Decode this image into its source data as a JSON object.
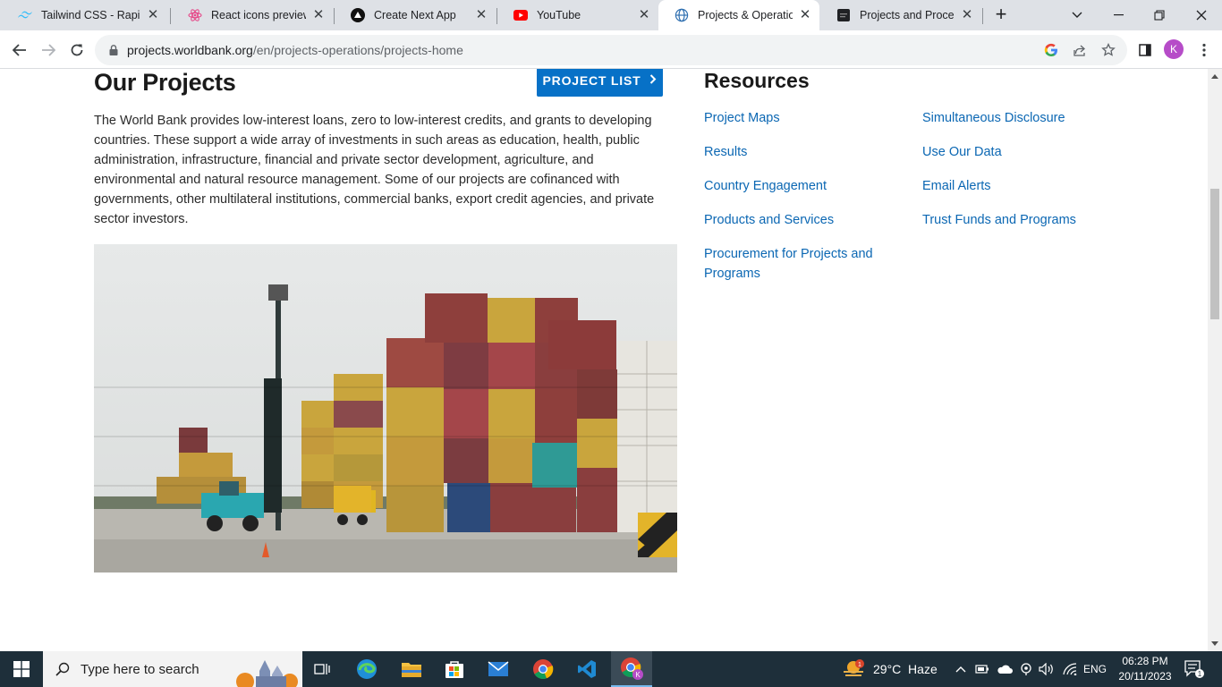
{
  "browser": {
    "tabs": [
      {
        "title": "Tailwind CSS - Rapidly",
        "icon": "tailwind-icon",
        "active": false
      },
      {
        "title": "React icons preview fo",
        "icon": "react-icon",
        "active": false
      },
      {
        "title": "Create Next App",
        "icon": "nextjs-icon",
        "active": false
      },
      {
        "title": "YouTube",
        "icon": "youtube-icon",
        "active": false
      },
      {
        "title": "Projects & Operation",
        "icon": "globe-icon",
        "active": true
      },
      {
        "title": "Projects and Processe",
        "icon": "document-icon",
        "active": false
      }
    ],
    "url_host": "projects.worldbank.org",
    "url_path": "/en/projects-operations/projects-home",
    "profile_initial": "K"
  },
  "page": {
    "projects_heading": "Our Projects",
    "project_list_button": "PROJECT LIST",
    "intro_text": "The World Bank provides low-interest loans, zero to low-interest credits, and grants to developing countries. These support a wide array of investments in such areas as education, health, public administration, infrastructure, financial and private sector development, agriculture, and environmental and natural resource management. Some of our projects are cofinanced with governments, other multilateral institutions, commercial banks, export credit agencies, and private sector investors.",
    "resources_heading": "Resources",
    "resources_col1": [
      "Project Maps",
      "Results",
      "Country Engagement",
      "Products and Services",
      "Procurement for Projects and Programs"
    ],
    "resources_col2": [
      "Simultaneous Disclosure",
      "Use Our Data",
      "Email Alerts",
      "Trust Funds and Programs"
    ]
  },
  "taskbar": {
    "search_placeholder": "Type here to search",
    "weather": "29°C  Haze",
    "weather_badge": "1",
    "language": "ENG",
    "time": "06:28 PM",
    "date": "20/11/2023",
    "notification_count": "1"
  },
  "colors": {
    "accent": "#0771c7",
    "link": "#0b67b3",
    "taskbar": "#1e2f3a"
  }
}
